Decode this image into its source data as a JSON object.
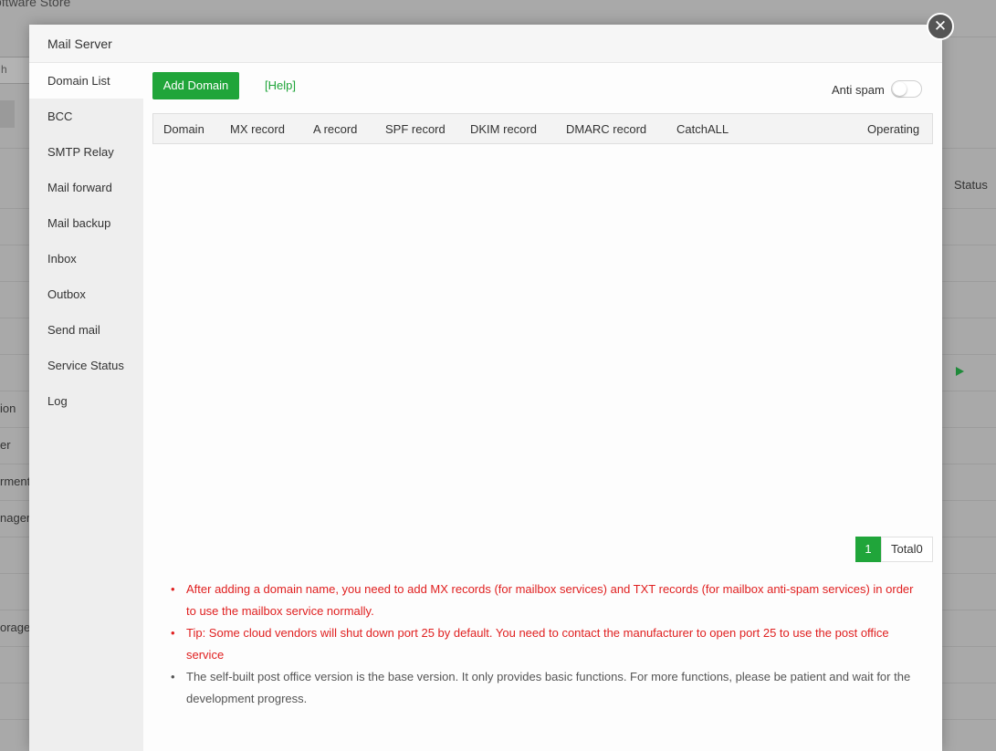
{
  "background": {
    "page_title": "oftware Store",
    "search_text": "h",
    "status_header": "Status",
    "left_labels": [
      "ion",
      "er",
      "rment",
      "nager",
      "orage"
    ]
  },
  "modal": {
    "title": "Mail Server",
    "close_icon": "close-icon",
    "sidebar": {
      "items": [
        {
          "label": "Domain List",
          "active": true
        },
        {
          "label": "BCC"
        },
        {
          "label": "SMTP Relay"
        },
        {
          "label": "Mail forward"
        },
        {
          "label": "Mail backup"
        },
        {
          "label": "Inbox"
        },
        {
          "label": "Outbox"
        },
        {
          "label": "Send mail"
        },
        {
          "label": "Service Status"
        },
        {
          "label": "Log"
        }
      ]
    },
    "toolbar": {
      "add_domain_label": "Add Domain",
      "help_label": "[Help]",
      "anti_spam_label": "Anti spam",
      "anti_spam_enabled": false
    },
    "table": {
      "columns": [
        "Domain",
        "MX record",
        "A record",
        "SPF record",
        "DKIM record",
        "DMARC record",
        "CatchALL",
        "Operating"
      ]
    },
    "pagination": {
      "current_page": "1",
      "total_label": "Total0"
    },
    "notes": [
      {
        "text": "After adding a domain name, you need to add MX records (for mailbox services) and TXT records (for mailbox anti-spam services) in order to use the mailbox service normally.",
        "color": "#e02020"
      },
      {
        "text": "Tip: Some cloud vendors will shut down port 25 by default. You need to contact the manufacturer to open port 25 to use the post office service",
        "color": "#e02020"
      },
      {
        "text": "The self-built post office version is the base version. It only provides basic functions. For more functions, please be patient and wait for the development progress.",
        "color": "#555555"
      }
    ]
  },
  "colors": {
    "accent": "#20a53a",
    "warning_text": "#e02020",
    "overlay": "#a9a9a9"
  }
}
